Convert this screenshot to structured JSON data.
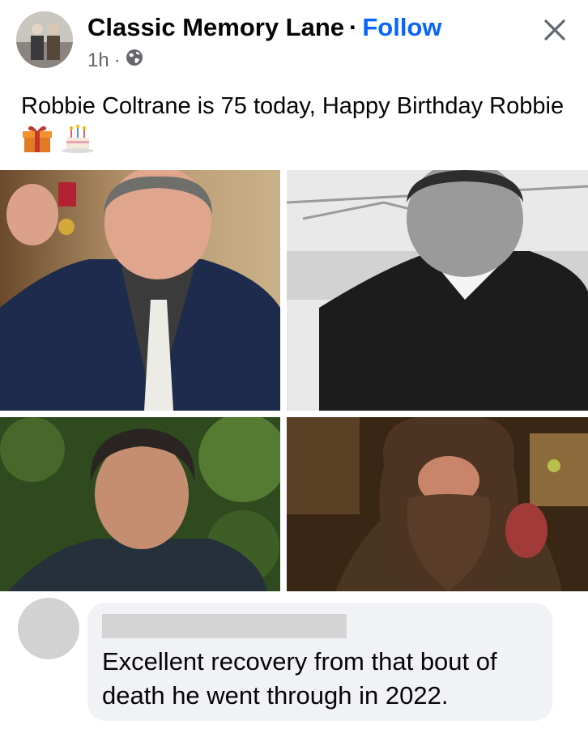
{
  "post": {
    "page_name": "Classic Memory Lane",
    "separator": "·",
    "follow_label": "Follow",
    "time": "1h",
    "meta_separator": "·",
    "audience_icon": "globe-icon",
    "close_icon": "close-icon",
    "text_main": "Robbie Coltrane is 75 today, Happy Birthday Robbie",
    "emojis": [
      "gift-icon",
      "birthday-cake-icon"
    ]
  },
  "photos": [
    {
      "name": "photo-holding-medal",
      "style": "color"
    },
    {
      "name": "photo-black-and-white-bridge",
      "style": "black-and-white"
    },
    {
      "name": "photo-green-foliage",
      "style": "color"
    },
    {
      "name": "photo-hagrid-costume",
      "style": "color"
    }
  ],
  "comment": {
    "text": "Excellent recovery from that bout of death he went through in 2022."
  },
  "colors": {
    "follow_blue": "#0866ff",
    "secondary_text": "#65676b",
    "comment_bg": "#f0f2f5"
  }
}
